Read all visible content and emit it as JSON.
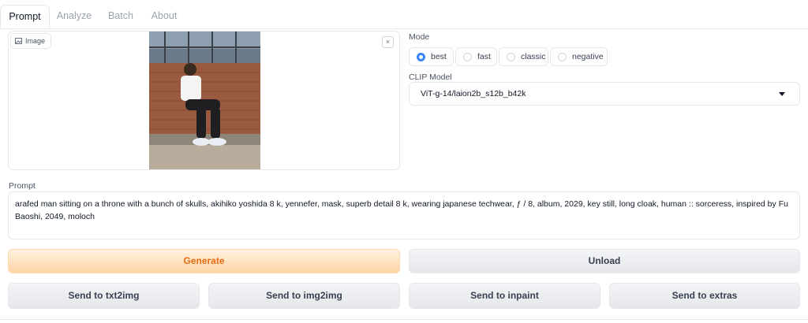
{
  "tabs": [
    {
      "label": "Prompt",
      "active": true
    },
    {
      "label": "Analyze",
      "active": false
    },
    {
      "label": "Batch",
      "active": false
    },
    {
      "label": "About",
      "active": false
    }
  ],
  "image_panel": {
    "label": "Image",
    "icon": "image-icon",
    "close_symbol": "×"
  },
  "mode": {
    "label": "Mode",
    "options": [
      "best",
      "fast",
      "classic",
      "negative"
    ],
    "selected": "best"
  },
  "clip_model": {
    "label": "CLIP Model",
    "value": "ViT-g-14/laion2b_s12b_b42k"
  },
  "prompt": {
    "label": "Prompt",
    "value": "arafed man sitting on a throne with a bunch of skulls, akihiko yoshida 8 k, yennefer, mask, superb detail 8 k, wearing japanese techwear, ƒ / 8, album, 2029, key still, long cloak, human :: sorceress, inspired by Fu Baoshi, 2049, moloch"
  },
  "buttons": {
    "generate": "Generate",
    "unload": "Unload",
    "send_txt2img": "Send to txt2img",
    "send_img2img": "Send to img2img",
    "send_inpaint": "Send to inpaint",
    "send_extras": "Send to extras"
  },
  "colors": {
    "accent": "#3b82f6",
    "primary_text": "#ea6a12"
  }
}
